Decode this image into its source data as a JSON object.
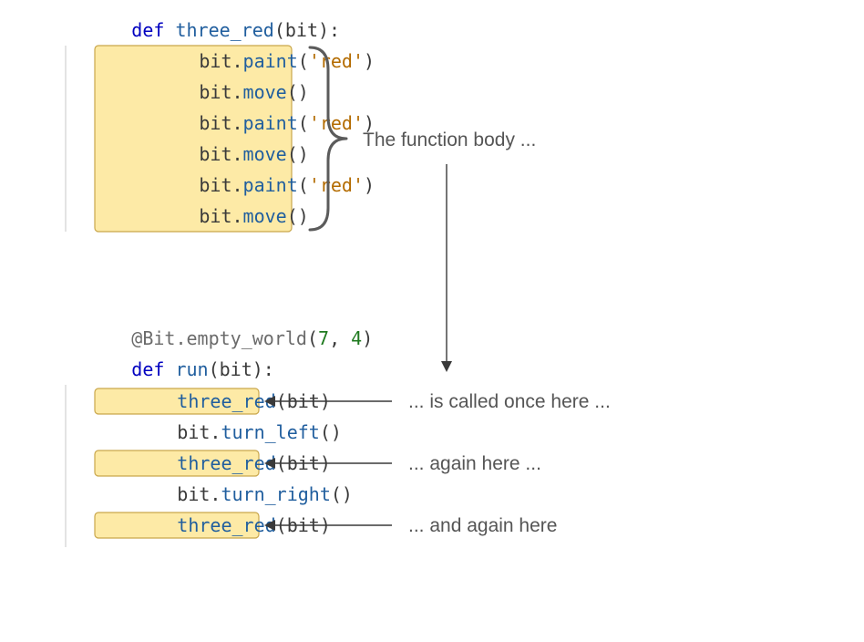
{
  "func1": {
    "def": "def",
    "name": "three_red",
    "param": "bit",
    "body": [
      {
        "obj": "bit",
        "method": "paint",
        "arg_type": "string",
        "arg": "'red'"
      },
      {
        "obj": "bit",
        "method": "move",
        "arg_type": "none",
        "arg": ""
      },
      {
        "obj": "bit",
        "method": "paint",
        "arg_type": "string",
        "arg": "'red'"
      },
      {
        "obj": "bit",
        "method": "move",
        "arg_type": "none",
        "arg": ""
      },
      {
        "obj": "bit",
        "method": "paint",
        "arg_type": "string",
        "arg": "'red'"
      },
      {
        "obj": "bit",
        "method": "move",
        "arg_type": "none",
        "arg": ""
      }
    ]
  },
  "decorator": {
    "at": "@",
    "class": "Bit",
    "method": "empty_world",
    "args": [
      "7",
      "4"
    ]
  },
  "func2": {
    "def": "def",
    "name": "run",
    "param": "bit",
    "body": [
      {
        "kind": "call",
        "func": "three_red",
        "arg": "bit",
        "highlight": true
      },
      {
        "kind": "method",
        "obj": "bit",
        "method": "turn_left"
      },
      {
        "kind": "call",
        "func": "three_red",
        "arg": "bit",
        "highlight": true
      },
      {
        "kind": "method",
        "obj": "bit",
        "method": "turn_right"
      },
      {
        "kind": "call",
        "func": "three_red",
        "arg": "bit",
        "highlight": true
      }
    ]
  },
  "annotations": {
    "body_label": "The function  body ...",
    "call1": "... is called once here ...",
    "call2": "... again here ...",
    "call3": "... and again here"
  },
  "colors": {
    "highlight_fill": "#fdeaa6",
    "highlight_stroke": "#c9a64b",
    "keyword": "#0000c0",
    "func": "#205e9e",
    "string": "#b36b00",
    "number": "#1f7a1f",
    "annot": "#555555"
  }
}
